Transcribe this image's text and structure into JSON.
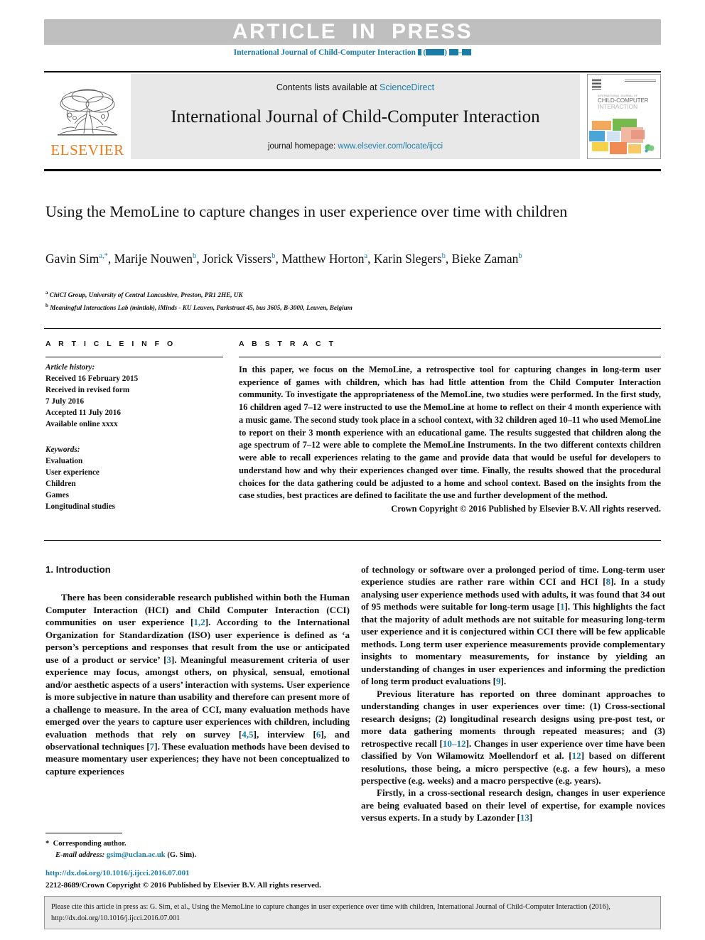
{
  "banner": {
    "text": "ARTICLE IN PRESS",
    "running_head_prefix": "International Journal of Child-Computer Interaction",
    "running_head_volume": "▮ (▮▮▮▮) ▮▮▮–▮▮▮"
  },
  "masthead": {
    "publisher": "ELSEVIER",
    "contents_prefix": "Contents lists available at ",
    "contents_link": "ScienceDirect",
    "journal_title": "International Journal of Child-Computer Interaction",
    "homepage_label": "journal homepage: ",
    "homepage_url": "www.elsevier.com/locate/ijcci",
    "cover": {
      "kicker": "INTERNATIONAL JOURNAL OF",
      "line1": "CHILD-COMPUTER",
      "line2": "INTERACTION"
    }
  },
  "article": {
    "title": "Using the MemoLine to capture changes in user experience over time with children",
    "authors": [
      {
        "name": "Gavin Sim",
        "marks": "a,*"
      },
      {
        "name": "Marije Nouwen",
        "marks": "b"
      },
      {
        "name": "Jorick Vissers",
        "marks": "b"
      },
      {
        "name": "Matthew Horton",
        "marks": "a"
      },
      {
        "name": "Karin Slegers",
        "marks": "b"
      },
      {
        "name": "Bieke Zaman",
        "marks": "b"
      }
    ],
    "affiliations": [
      {
        "mark": "a",
        "text": "ChiCI Group, University of Central Lancashire, Preston, PR1 2HE, UK"
      },
      {
        "mark": "b",
        "text": "Meaningful Interactions Lab (mintlab), iMinds - KU Leuven, Parkstraat 45, bus 3605, B-3000, Leuven, Belgium"
      }
    ]
  },
  "info": {
    "heading": "A R T I C L E   I N F O",
    "history_label": "Article history:",
    "history": [
      "Received 16 February 2015",
      "Received in revised form",
      "7 July 2016",
      "Accepted 11 July 2016",
      "Available online xxxx"
    ],
    "keywords_label": "Keywords:",
    "keywords": [
      "Evaluation",
      "User experience",
      "Children",
      "Games",
      "Longitudinal studies"
    ]
  },
  "abstract": {
    "heading": "A B S T R A C T",
    "body": "In this paper, we focus on the MemoLine, a retrospective tool for capturing changes in long-term user experience of games with children, which has had little attention from the Child Computer Interaction community. To investigate the appropriateness of the MemoLine, two studies were performed. In the first study, 16 children aged 7–12 were instructed to use the MemoLine at home to reflect on their 4 month experience with a music game. The second study took place in a school context, with 32 children aged 10–11 who used MemoLine to report on their 3 month experience with an educational game. The results suggested that children along the age spectrum of 7–12 were able to complete the MemoLine Instruments. In the two different contexts children were able to recall experiences relating to the game and provide data that would be useful for developers to understand how and why their experiences changed over time. Finally, the results showed that the procedural choices for the data gathering could be adjusted to a home and school context. Based on the insights from the case studies, best practices are defined to facilitate the use and further development of the method.",
    "copyright": "Crown Copyright © 2016 Published by Elsevier B.V. All rights reserved."
  },
  "intro": {
    "heading": "1. Introduction",
    "left_paragraphs": [
      "There has been considerable research published within both the Human Computer Interaction (HCI) and Child Computer Interaction (CCI) communities on user experience [1,2]. According to the International Organization for Standardization (ISO) user experience is defined as ‘a person’s perceptions and responses that result from the use or anticipated use of a product or service’ [3]. Meaningful measurement criteria of user experience may focus, amongst others, on physical, sensual, emotional and/or aesthetic aspects of a users’ interaction with systems. User experience is more subjective in nature than usability and therefore can present more of a challenge to measure. In the area of CCI, many evaluation methods have emerged over the years to capture user experiences with children, including evaluation methods that rely on survey [4,5], interview [6], and observational techniques [7]. These evaluation methods have been devised to measure momentary user experiences; they have not been conceptualized to capture experiences"
    ],
    "right_paragraphs": [
      "of technology or software over a prolonged period of time. Long-term user experience studies are rather rare within CCI and HCI [8]. In a study analysing user experience methods used with adults, it was found that 34 out of 95 methods were suitable for long-term usage [1]. This highlights the fact that the majority of adult methods are not suitable for measuring long-term user experience and it is conjectured within CCI there will be few applicable methods. Long term user experience measurements provide complementary insights to momentary measurements, for instance by yielding an understanding of changes in user experiences and informing the prediction of long term product evaluations [9].",
      "Previous literature has reported on three dominant approaches to understanding changes in user experiences over time: (1) Cross-sectional research designs; (2) longitudinal research designs using pre-post test, or more data gathering moments through repeated measures; and (3) retrospective recall [10–12]. Changes in user experience over time have been classified by Von Wilamowitz Moellendorf et al. [12] based on different resolutions, those being, a micro perspective (e.g. a few hours), a meso perspective (e.g. weeks) and a macro perspective (e.g. years).",
      "Firstly, in a cross-sectional research design, changes in user experience are being evaluated based on their level of expertise, for example novices versus experts. In a study by Lazonder [13]"
    ]
  },
  "footnote": {
    "star": "*",
    "corresponding": "Corresponding author.",
    "email_label": "E-mail address:",
    "email": "gsim@uclan.ac.uk",
    "email_suffix": "(G. Sim).",
    "doi_url": "http://dx.doi.org/10.1016/j.ijcci.2016.07.001",
    "issn_line": "2212-8689/Crown Copyright © 2016 Published by Elsevier B.V. All rights reserved."
  },
  "cite_box": {
    "text": "Please cite this article in press as: G. Sim, et al., Using the MemoLine to capture changes in user experience over time with children, International Journal of Child-Computer Interaction (2016), http://dx.doi.org/10.1016/j.ijcci.2016.07.001"
  },
  "colors": {
    "link": "#1b7ca8",
    "banner_bg": "#bfbfbf",
    "masthead_bg": "#e8e8e8",
    "elsevier_orange": "#e87d1e"
  }
}
